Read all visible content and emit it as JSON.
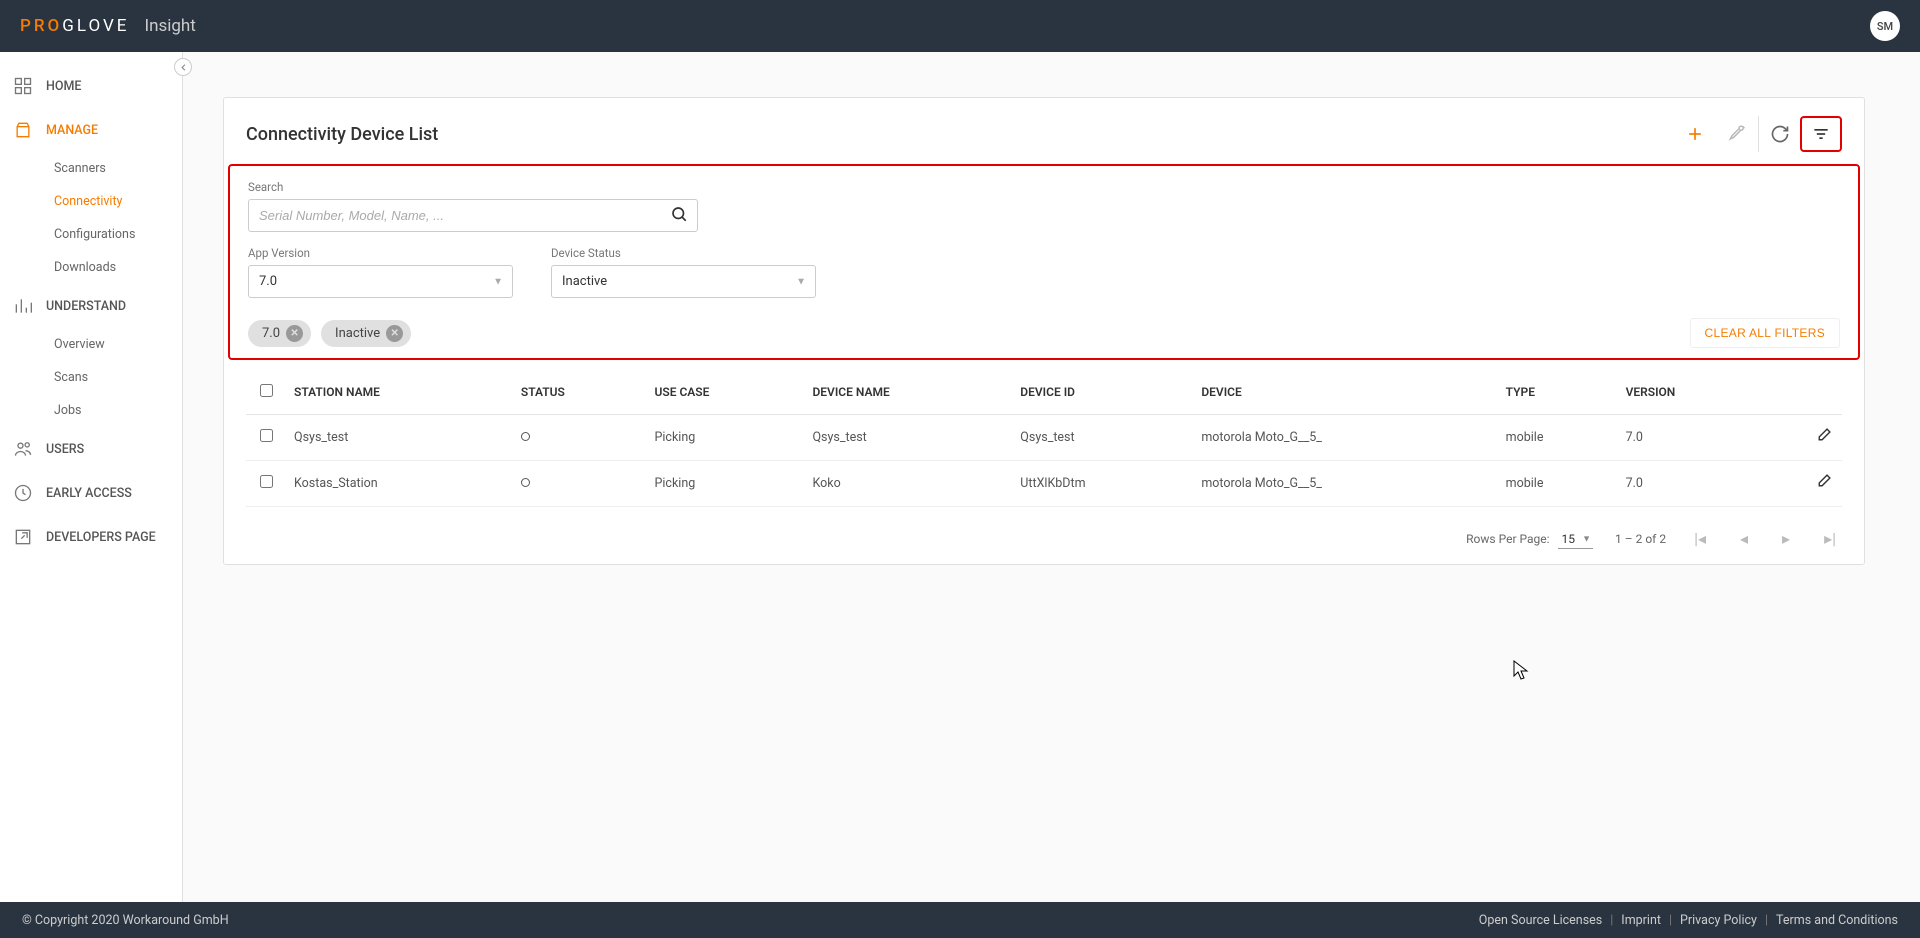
{
  "header": {
    "logo_pro": "PRO",
    "logo_glove": "GLOVE",
    "product": "Insight",
    "avatar_initials": "SM"
  },
  "sidebar": {
    "home": "HOME",
    "manage": "MANAGE",
    "manage_items": {
      "scanners": "Scanners",
      "connectivity": "Connectivity",
      "configurations": "Configurations",
      "downloads": "Downloads"
    },
    "understand": "UNDERSTAND",
    "understand_items": {
      "overview": "Overview",
      "scans": "Scans",
      "jobs": "Jobs"
    },
    "users": "USERS",
    "early_access": "EARLY ACCESS",
    "developers": "DEVELOPERS PAGE"
  },
  "page": {
    "title": "Connectivity Device List",
    "filters": {
      "search_label": "Search",
      "search_placeholder": "Serial Number, Model, Name, ...",
      "app_version_label": "App Version",
      "app_version_value": "7.0",
      "device_status_label": "Device Status",
      "device_status_value": "Inactive",
      "chips": {
        "app_version": "7.0",
        "device_status": "Inactive"
      },
      "clear_all": "CLEAR ALL FILTERS"
    },
    "table": {
      "headers": {
        "station": "STATION NAME",
        "status": "STATUS",
        "usecase": "USE CASE",
        "devicename": "DEVICE NAME",
        "deviceid": "DEVICE ID",
        "device": "DEVICE",
        "type": "TYPE",
        "version": "VERSION"
      },
      "rows": [
        {
          "station": "Qsys_test",
          "usecase": "Picking",
          "devicename": "Qsys_test",
          "deviceid": "Qsys_test",
          "device": "motorola Moto_G__5_",
          "type": "mobile",
          "version": "7.0"
        },
        {
          "station": "Kostas_Station",
          "usecase": "Picking",
          "devicename": "Koko",
          "deviceid": "UttXlKbDtm",
          "device": "motorola Moto_G__5_",
          "type": "mobile",
          "version": "7.0"
        }
      ]
    },
    "pagination": {
      "rows_label": "Rows Per Page:",
      "rows_value": "15",
      "range": "1 – 2 of 2"
    }
  },
  "footer": {
    "copyright": "© Copyright 2020 Workaround GmbH",
    "links": {
      "opensource": "Open Source Licenses",
      "imprint": "Imprint",
      "privacy": "Privacy Policy",
      "terms": "Terms and Conditions"
    }
  }
}
